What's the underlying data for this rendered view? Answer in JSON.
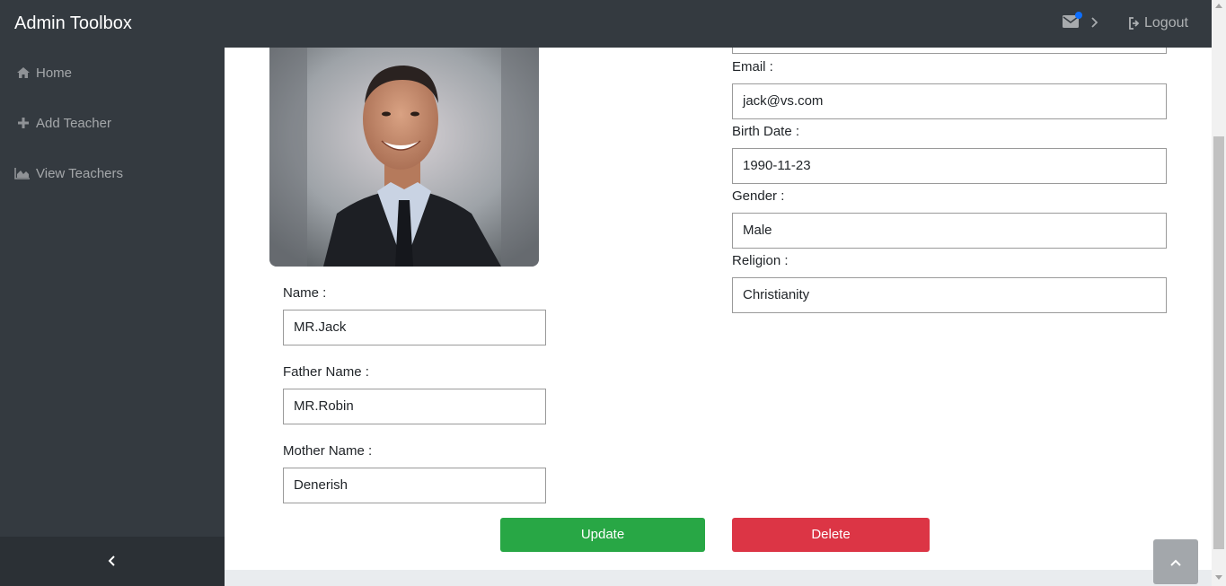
{
  "app": {
    "title": "Admin Toolbox"
  },
  "topbar": {
    "logout_label": "Logout"
  },
  "sidebar": {
    "items": [
      {
        "label": "Home",
        "icon": "home-icon"
      },
      {
        "label": "Add Teacher",
        "icon": "plus-icon"
      },
      {
        "label": "View Teachers",
        "icon": "chart-area-icon"
      }
    ]
  },
  "form": {
    "name_label": "Name :",
    "name_value": "MR.Jack",
    "father_label": "Father Name :",
    "father_value": "MR.Robin",
    "mother_label": "Mother Name :",
    "mother_value": "Denerish",
    "email_label": "Email :",
    "email_value": "jack@vs.com",
    "birth_label": "Birth Date :",
    "birth_value": "1990-11-23",
    "gender_label": "Gender :",
    "gender_value": "Male",
    "religion_label": "Religion :",
    "religion_value": "Christianity"
  },
  "actions": {
    "update_label": "Update",
    "delete_label": "Delete"
  },
  "colors": {
    "navbar": "#343a40",
    "update": "#28a745",
    "delete": "#dc3545",
    "notification_dot": "#0d6efd"
  }
}
